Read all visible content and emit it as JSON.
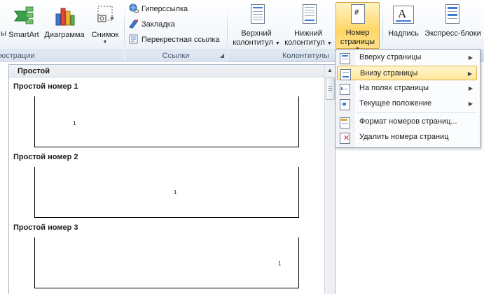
{
  "ribbon": {
    "buttons": {
      "shapes_partial": "ы",
      "smartart": "SmartArt",
      "diagram": "Диаграмма",
      "snapshot": "Снимок",
      "header_line1": "Верхний",
      "header_line2": "колонтитул",
      "footer_line1": "Нижний",
      "footer_line2": "колонтитул",
      "pagenum_line1": "Номер",
      "pagenum_line2": "страницы",
      "textbox": "Надпись",
      "quickparts": "Экспресс-блоки"
    },
    "links": {
      "hyperlink": "Гиперссылка",
      "bookmark": "Закладка",
      "crossref": "Перекрестная ссылка"
    },
    "groups": {
      "illustrations_partial": "юстрации",
      "links": "Ссылки",
      "headers_footers": "Колонтитулы"
    }
  },
  "gallery": {
    "header": "Простой",
    "items": [
      {
        "title": "Простой номер 1",
        "number": "1"
      },
      {
        "title": "Простой номер 2",
        "number": "1"
      },
      {
        "title": "Простой номер 3",
        "number": "1"
      }
    ]
  },
  "menu": {
    "items": [
      {
        "label": "Вверху страницы",
        "has_submenu": true
      },
      {
        "label": "Внизу страницы",
        "has_submenu": true,
        "highlighted": true
      },
      {
        "label": "На полях страницы",
        "has_submenu": true
      },
      {
        "label": "Текущее положение",
        "has_submenu": true
      },
      {
        "label": "Формат номеров страниц...",
        "has_submenu": false
      },
      {
        "label": "Удалить номера страниц",
        "has_submenu": false
      }
    ],
    "submenu_arrow": "▶"
  },
  "colors": {
    "highlight_fill": "#ffe59a",
    "highlight_border": "#e3b446",
    "ribbon_bg": "#f4f7fb"
  }
}
